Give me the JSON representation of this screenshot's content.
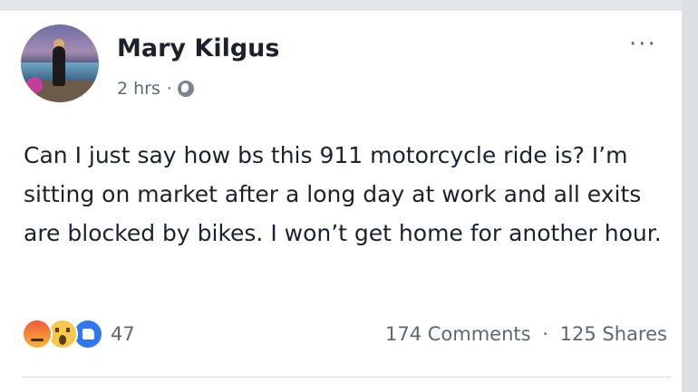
{
  "post": {
    "author": "Mary Kilgus",
    "time": "2 hrs",
    "separator": "·",
    "text": "Can I just say how bs this 911 motorcycle ride is? I’m sitting on market after a long day at work and all exits are blocked by bikes. I won’t get home for another hour.",
    "privacy_icon": "globe-icon",
    "more_icon": "more-options-icon"
  },
  "footer": {
    "reactions": [
      "angry-reaction-icon",
      "wow-reaction-icon",
      "like-reaction-icon"
    ],
    "reaction_count": "47",
    "comments": "174 Comments",
    "separator": "·",
    "shares": "125 Shares"
  },
  "colors": {
    "like_blue": "#2f78ee",
    "angry": "#f25a3a",
    "wow": "#f7c94b",
    "text": "#1d2129",
    "muted": "#616770"
  }
}
